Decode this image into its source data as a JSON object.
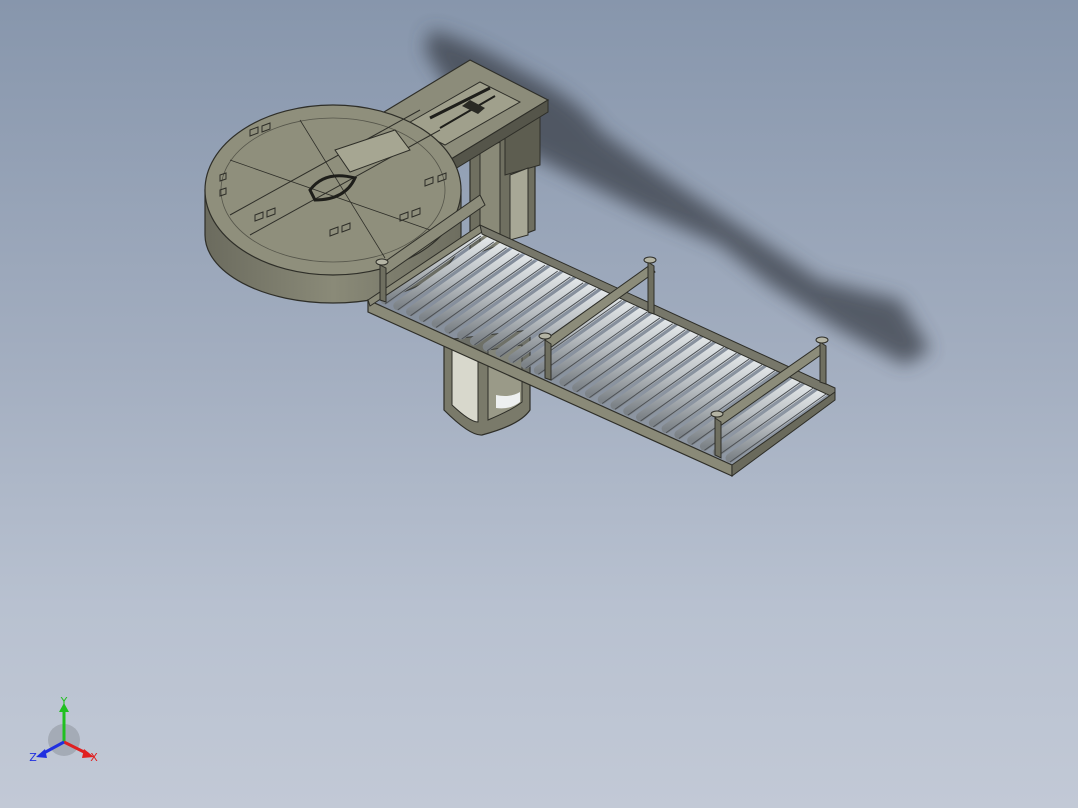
{
  "viewport": {
    "background_top": "#8796ac",
    "background_bottom": "#c2c9d6"
  },
  "model": {
    "body_color": "#7a7a6a",
    "edge_color": "#2e2e28",
    "roller_color": "#c8cccd",
    "shadow_color": "#3a3f48"
  },
  "triad": {
    "x_label": "X",
    "y_label": "Y",
    "z_label": "Z",
    "x_color": "#e02020",
    "y_color": "#20c020",
    "z_color": "#2030e0"
  }
}
